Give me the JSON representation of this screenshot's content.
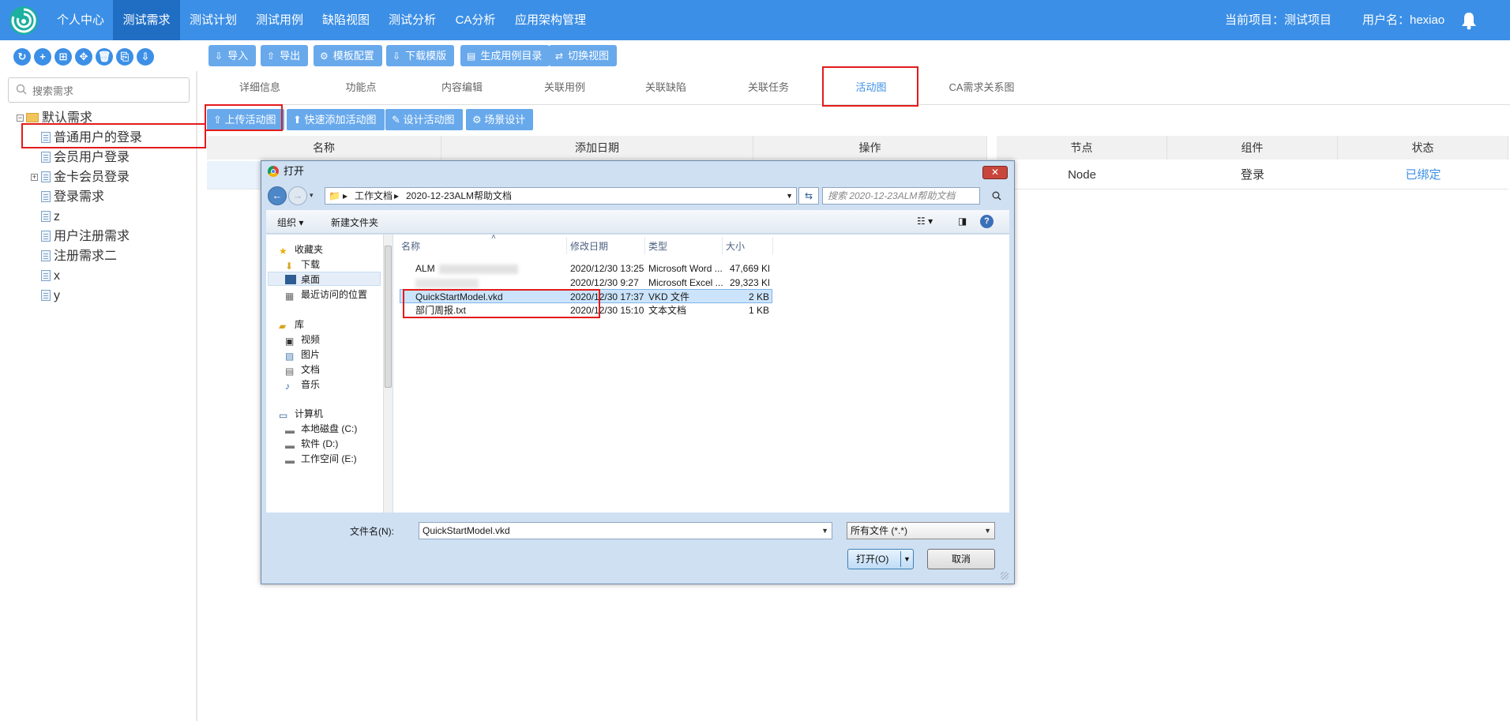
{
  "nav": {
    "items": [
      "个人中心",
      "测试需求",
      "测试计划",
      "测试用例",
      "缺陷视图",
      "测试分析",
      "CA分析",
      "应用架构管理"
    ],
    "active_index": 1,
    "project_label": "当前项目：测试项目",
    "user_label": "用户名：hexiao"
  },
  "toolbar": {
    "import": "导入",
    "export": "导出",
    "template_config": "模板配置",
    "download_template": "下载模版",
    "generate_catalog": "生成用例目录",
    "switch_view": "切换视图"
  },
  "search": {
    "placeholder": "搜索需求"
  },
  "tree": {
    "root": "默认需求",
    "items": [
      "普通用户的登录",
      "会员用户登录",
      "金卡会员登录",
      "登录需求",
      "z",
      "用户注册需求",
      "注册需求二",
      "x",
      "y"
    ]
  },
  "tabs": {
    "items": [
      "详细信息",
      "功能点",
      "内容编辑",
      "关联用例",
      "关联缺陷",
      "关联任务",
      "活动图",
      "CA需求关系图"
    ],
    "active_index": 6
  },
  "sub_actions": {
    "upload": "上传活动图",
    "quick_add": "快速添加活动图",
    "design": "设计活动图",
    "scene": "场景设计"
  },
  "left_table": {
    "headers": [
      "名称",
      "添加日期",
      "操作"
    ]
  },
  "right_table": {
    "headers": [
      "节点",
      "组件",
      "状态"
    ],
    "rows": [
      {
        "node": "Node",
        "component": "登录",
        "status": "已绑定"
      }
    ]
  },
  "dialog": {
    "title": "打开",
    "breadcrumb": [
      "工作文档",
      "2020-12-23ALM帮助文档"
    ],
    "search_placeholder": "搜索 2020-12-23ALM帮助文档",
    "organize": "组织 ▾",
    "new_folder": "新建文件夹",
    "nav": {
      "favorites": "收藏夹",
      "downloads": "下载",
      "desktop": "桌面",
      "recent": "最近访问的位置",
      "libraries": "库",
      "videos": "视频",
      "pictures": "图片",
      "documents": "文档",
      "music": "音乐",
      "computer": "计算机",
      "disk_c": "本地磁盘 (C:)",
      "disk_d": "软件 (D:)",
      "disk_e": "工作空间 (E:)"
    },
    "columns": [
      "名称",
      "修改日期",
      "类型",
      "大小"
    ],
    "files": [
      {
        "name": "ALM",
        "date": "2020/12/30 13:25",
        "type": "Microsoft Word ...",
        "size": "47,669 KB"
      },
      {
        "name": "",
        "date": "2020/12/30 9:27",
        "type": "Microsoft Excel ...",
        "size": "29,323 KB"
      },
      {
        "name": "QuickStartModel.vkd",
        "date": "2020/12/30 17:37",
        "type": "VKD 文件",
        "size": "2 KB"
      },
      {
        "name": "部门周报.txt",
        "date": "2020/12/30 15:10",
        "type": "文本文档",
        "size": "1 KB"
      }
    ],
    "filename_label": "文件名(N):",
    "filename_value": "QuickStartModel.vkd",
    "filetype": "所有文件 (*.*)",
    "open": "打开(O)",
    "cancel": "取消"
  },
  "colors": {
    "nav_bg": "#3c8fe6",
    "nav_active": "#1f6ec4",
    "button": "#68a9ec",
    "highlight": "#e31b1b"
  }
}
